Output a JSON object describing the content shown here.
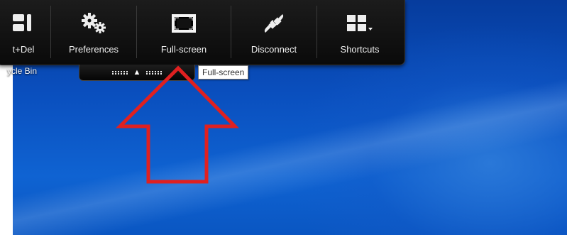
{
  "desktop": {
    "recycle_bin_label": "ycle Bin"
  },
  "toolbar": {
    "items": [
      {
        "label": "t+Del",
        "icon": "keyboard-icon"
      },
      {
        "label": "Preferences",
        "icon": "gears-icon"
      },
      {
        "label": "Full-screen",
        "icon": "fullscreen-icon"
      },
      {
        "label": "Disconnect",
        "icon": "plug-icon"
      },
      {
        "label": "Shortcuts",
        "icon": "grid-dropdown-icon"
      }
    ]
  },
  "tooltip": {
    "text": "Full-screen"
  },
  "handle": {
    "icon": "up-arrow-icon"
  },
  "annotation": {
    "icon": "red-up-arrow-icon",
    "color": "#e02020"
  }
}
